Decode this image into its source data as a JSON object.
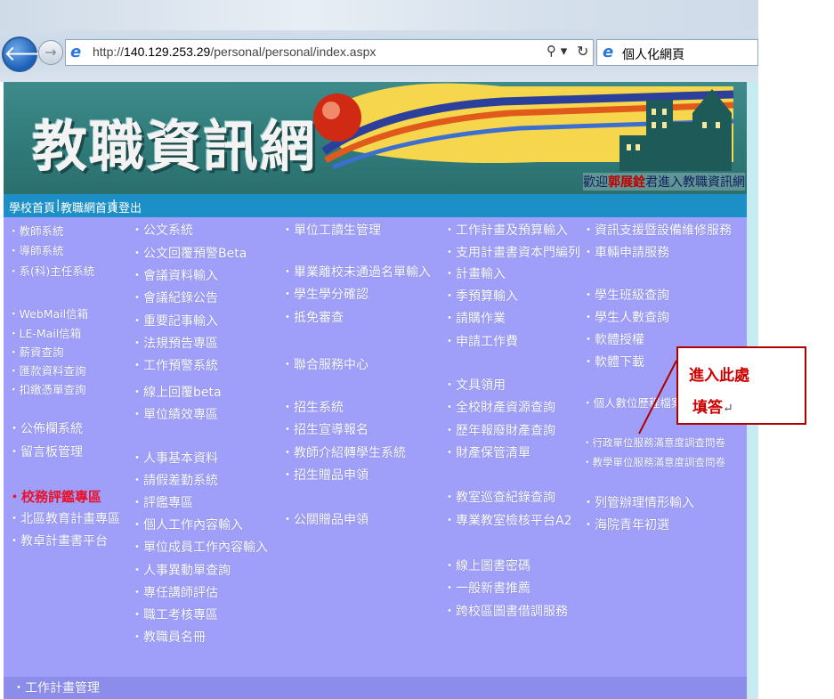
{
  "browser": {
    "url_prefix": "http://",
    "url_host": "140.129.253.29",
    "url_path": "/personal/personal/index.aspx",
    "search_symbol": "⚲ ▾",
    "refresh_symbol": "↻",
    "tab_title": "個人化網頁"
  },
  "banner": {
    "logo_text": "教職資訊網",
    "welcome_prefix": "歡迎",
    "user_name": "郭展銓",
    "welcome_suffix": "君進入教職資訊網"
  },
  "nav": {
    "items": [
      "學校首頁",
      "教職網首頁",
      "登出"
    ],
    "separator": "|"
  },
  "columns": {
    "col1": [
      "・教師系統",
      "・導師系統",
      "・系(科)主任系統",
      "・WebMail信箱",
      "・LE-Mail信箱",
      "・薪資查詢",
      "・匯款資料查詢",
      "・扣繳憑單查詢",
      "・公佈欄系統",
      "・留言板管理",
      "・校務評鑑專區",
      "・北區教育計畫專區",
      "・教卓計畫書平台"
    ],
    "col2": [
      "・公文系統",
      "・公文回覆預警Beta",
      "・會議資料輸入",
      "・會議紀錄公告",
      "・重要記事輸入",
      "・法規預告專區",
      "・工作預警系統",
      "・線上回覆beta",
      "・單位績效專區",
      "・人事基本資料",
      "・請假差勤系統",
      "・評鑑專區",
      "・個人工作內容輸入",
      "・單位成員工作內容輸入",
      "・人事異動單查詢",
      "・專任講師評估",
      "・職工考核專區",
      "・教職員名冊"
    ],
    "col3": [
      "・單位工讀生管理",
      "・畢業離校未通過名單輸入",
      "・學生學分確認",
      "・抵免審查",
      "・聯合服務中心",
      "・招生系統",
      "・招生宣導報名",
      "・教師介紹轉學生系統",
      "・招生贈品申領",
      "・公關贈品申領"
    ],
    "col4": [
      "・工作計畫及預算輸入",
      "・支用計畫書資本門編列",
      "・計畫輸入",
      "・季預算輸入",
      "・請購作業",
      "・申請工作費",
      "・文具領用",
      "・全校財產資源查詢",
      "・歷年報廢財產查詢",
      "・財產保管清單",
      "・教室巡查紀錄查詢",
      "・專業教室檢核平台A2",
      "・線上圖書密碼",
      "・一般新書推薦",
      "・跨校區圖書借調服務"
    ],
    "col5": [
      "・資訊支援暨設備維修服務",
      "・車輛申請服務",
      "・學生班級查詢",
      "・學生人數查詢",
      "・軟體授權",
      "・軟體下載",
      "・個人數位歷程檔案系統",
      "・行政單位服務滿意度調查問卷",
      "・教學單位服務滿意度調查問卷",
      "・列管辦理情形輸入",
      "・海院青年初選"
    ]
  },
  "footer": {
    "item": "・工作計畫管理"
  },
  "callout": {
    "line1": "進入此處",
    "line2": "填答",
    "mark": "↵"
  },
  "colors": {
    "content_bg": "#9f9ff9",
    "banner_bg": "#2f7a79",
    "nav_bg": "#1c8fc7",
    "highlight": "#e8122a"
  }
}
